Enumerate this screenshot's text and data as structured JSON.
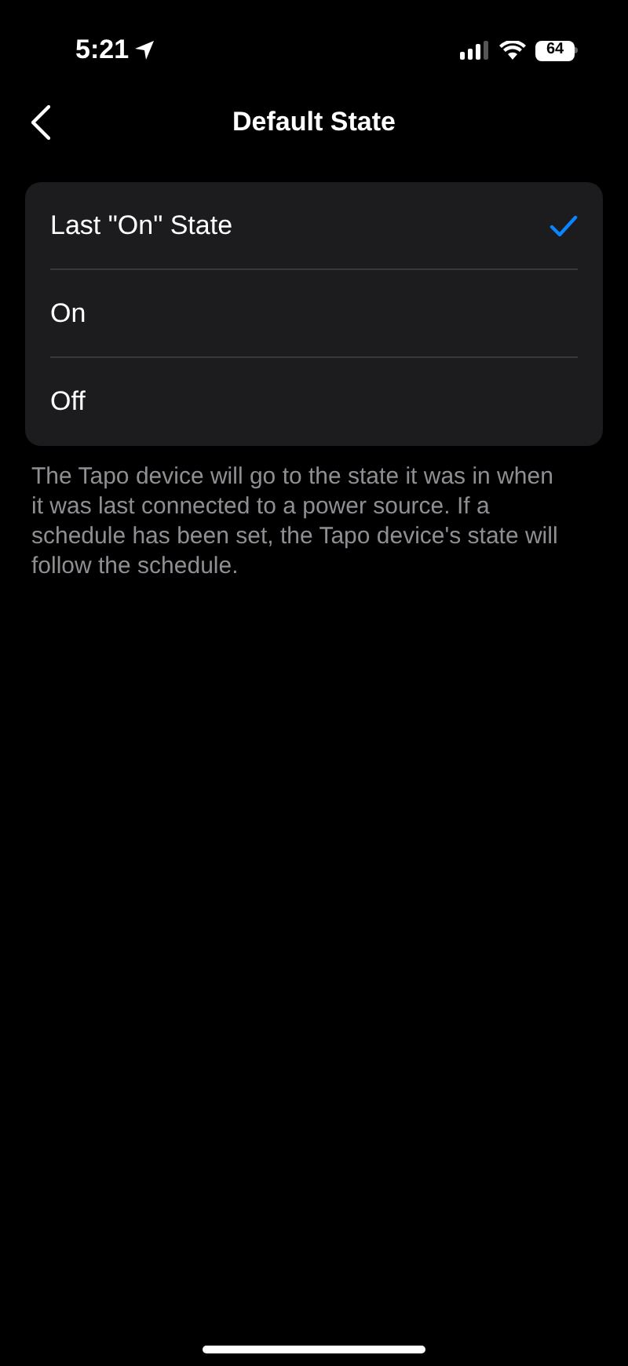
{
  "status_bar": {
    "time": "5:21",
    "battery": "64"
  },
  "nav": {
    "title": "Default State"
  },
  "options": [
    {
      "label": "Last \"On\" State",
      "selected": true
    },
    {
      "label": "On",
      "selected": false
    },
    {
      "label": "Off",
      "selected": false
    }
  ],
  "footnote": "The Tapo device will go to the state it was in when it was last connected to a power source. If a schedule has been set, the Tapo device's state will follow the schedule."
}
